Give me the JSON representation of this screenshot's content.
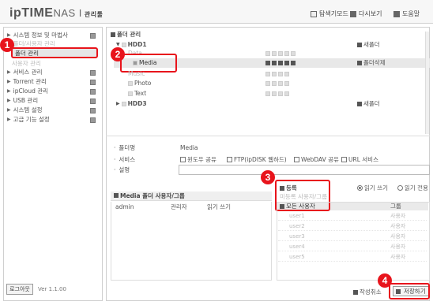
{
  "header": {
    "logo_brand": "ipTIME",
    "logo_model": "NAS I",
    "logo_sub": "관리툴",
    "links": [
      "탐색기모드",
      "다시보기",
      "도움말"
    ]
  },
  "sidebar": {
    "items": [
      {
        "label": "시스템 정보 및 마법사"
      },
      {
        "label": "폴더/사용자 관리"
      },
      {
        "label": "폴더 관리"
      },
      {
        "label": "사용자 관리"
      },
      {
        "label": "서비스 관리"
      },
      {
        "label": "Torrent 관리"
      },
      {
        "label": "ipCloud 관리"
      },
      {
        "label": "USB 관리"
      },
      {
        "label": "시스템 설정"
      },
      {
        "label": "고급 기능 설정"
      }
    ],
    "logout_label": "로그아웃",
    "version": "Ver 1.1.00"
  },
  "folders": {
    "title": "폴더 관리",
    "hdd1": "HDD1",
    "hdd3": "HDD3",
    "new_folder": "새폴더",
    "delete_folder": "폴더삭제",
    "folders": [
      "Data",
      "Media",
      "Music",
      "Photo",
      "Text"
    ]
  },
  "details": {
    "name_label": "폴더명",
    "name_value": "Media",
    "service_label": "서비스",
    "desc_label": "설명",
    "services": [
      "윈도우 공유",
      "FTP(ipDISK 웹하드)",
      "WebDAV 공유",
      "URL 서비스"
    ],
    "perm_write": "읽기 쓰기",
    "perm_read": "읽기 전용"
  },
  "users_panel": {
    "title": "Media 폴더 사용자/그룹",
    "rows": [
      {
        "name": "admin",
        "role": "관리자",
        "perm": "읽기 쓰기"
      }
    ]
  },
  "add_panel": {
    "register": "등록",
    "unreg_title": "미등록 사용자/그룹",
    "all_users": "모든 사용자",
    "group_header": "그룹",
    "users": [
      {
        "name": "user1",
        "group": "사용자"
      },
      {
        "name": "user2",
        "group": "사용자"
      },
      {
        "name": "user3",
        "group": "사용자"
      },
      {
        "name": "user4",
        "group": "사용자"
      },
      {
        "name": "user5",
        "group": "사용자"
      }
    ]
  },
  "actions": {
    "reset": "작성취소",
    "save": "저장하기"
  },
  "badges": [
    "1",
    "2",
    "3",
    "4"
  ]
}
